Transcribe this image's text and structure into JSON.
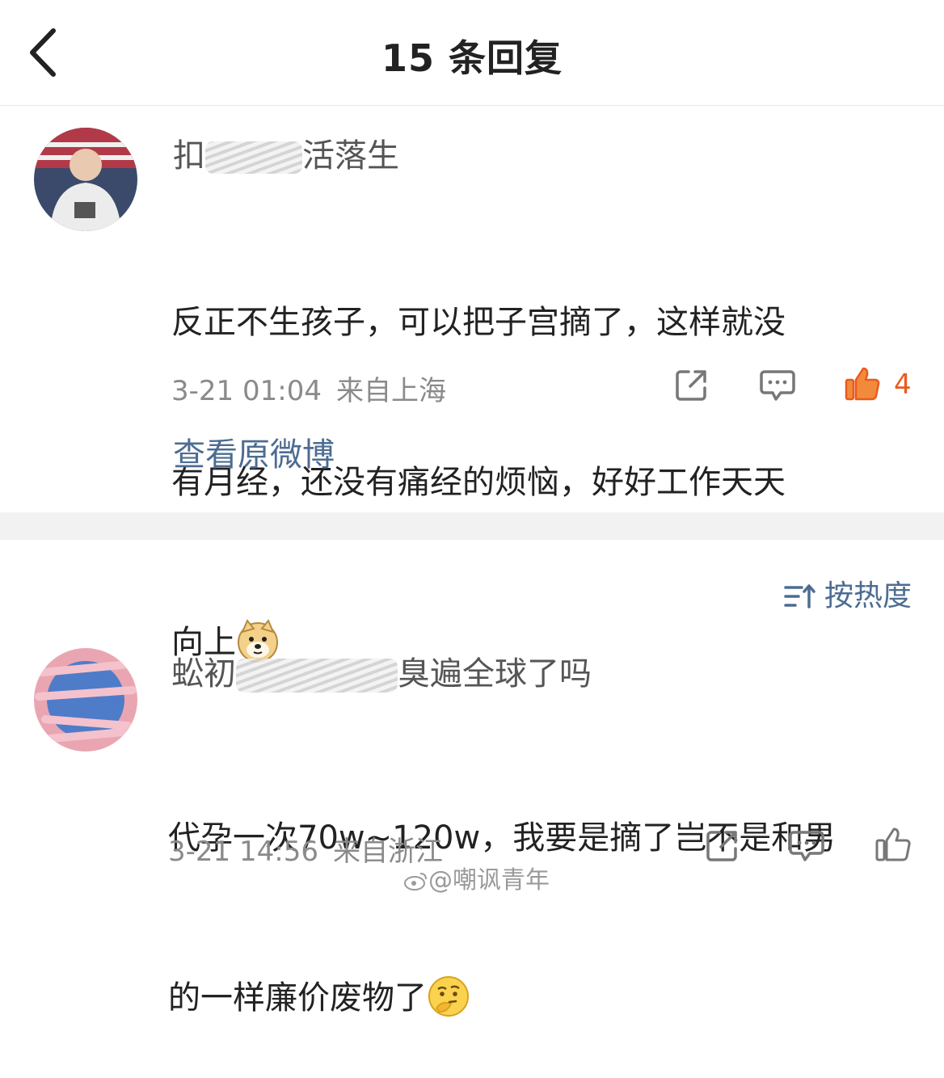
{
  "header": {
    "title": "15 条回复"
  },
  "top_comment": {
    "username_visible_start": "扣",
    "username_visible_end": "活落生",
    "text_line1": "反正不生孩子，可以把子宫摘了，这样就没",
    "text_line2": "有月经，还没有痛经的烦恼，好好工作天天",
    "text_line3": "向上",
    "emoji_icon": "doge-emoji-icon",
    "time": "3-21 01:04",
    "location": "来自上海",
    "like_count": "4",
    "like_color": "#ea5a1e"
  },
  "view_original_label": "查看原微博",
  "sort": {
    "label": "按热度"
  },
  "reply": {
    "username_visible_start": "蚣初",
    "username_visible_end": "臭遍全球了吗",
    "text_line1": "代孕一次70w~120w，我要是摘了岂不是和男",
    "text_line2": "的一样廉价废物了",
    "emoji_icon": "thinking-emoji-icon",
    "time": "3-21 14:56",
    "location": "来自浙江"
  },
  "watermark": "@嘲讽青年",
  "colors": {
    "link": "#4d6c92",
    "meta": "#8a8a8a",
    "divider": "#f2f2f2"
  }
}
